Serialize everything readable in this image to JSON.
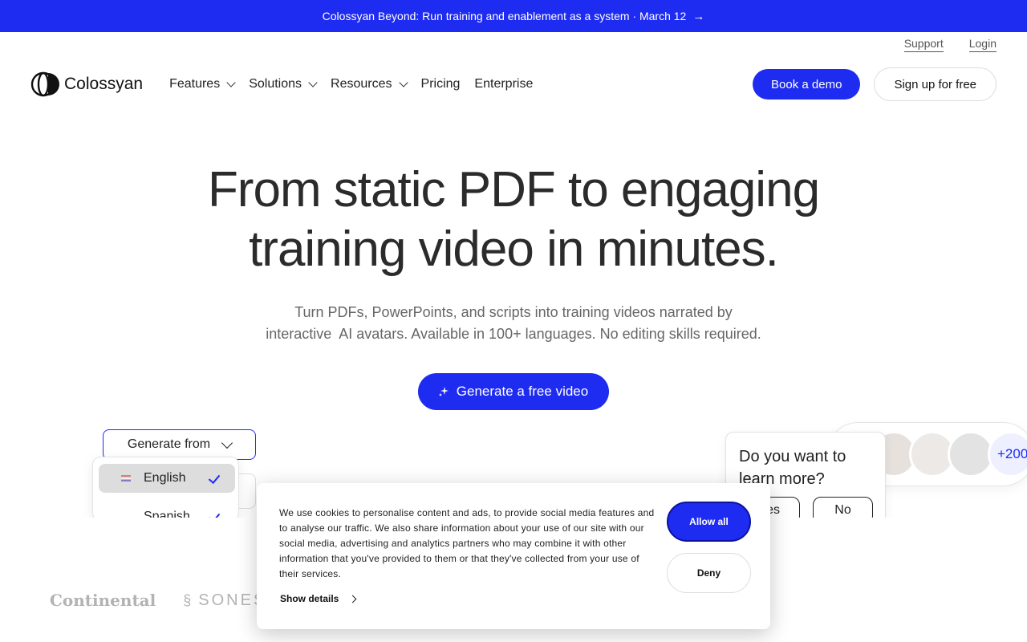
{
  "announcement": {
    "text": "Colossyan Beyond: Run training and enablement as a system · March 12",
    "arrow_icon": "arrow-right-icon"
  },
  "top_links": {
    "support": "Support",
    "login": "Login"
  },
  "nav": {
    "brand": "Colossyan",
    "menu": [
      {
        "label": "Features",
        "has_dropdown": true
      },
      {
        "label": "Solutions",
        "has_dropdown": true
      },
      {
        "label": "Resources",
        "has_dropdown": true
      },
      {
        "label": "Pricing",
        "has_dropdown": false
      },
      {
        "label": "Enterprise",
        "has_dropdown": false
      }
    ],
    "book_demo": "Book a demo",
    "sign_up": "Sign up for free"
  },
  "hero": {
    "title_line1": "From static PDF to engaging",
    "title_line2": "training video in minutes.",
    "subtitle_line1": "Turn PDFs, PowerPoints, and scripts into training videos narrated by",
    "subtitle_line2": "interactive  AI avatars. Available in 100+ languages. No editing skills required.",
    "cta": "Generate a free video"
  },
  "demo": {
    "generate_from": "Generate from",
    "languages": [
      {
        "label": "English",
        "selected": true
      },
      {
        "label": "Spanish",
        "selected": true
      }
    ],
    "learn_more": {
      "question_line1": "Do you want to",
      "question_line2": "learn more?",
      "yes": "es",
      "no": "No"
    },
    "avatars_more": "+200"
  },
  "client_logos": [
    "Continental",
    "SONEST"
  ],
  "cookie_banner": {
    "text": "We use cookies to personalise content and ads, to provide social media features and to analyse our traffic. We also share information about your use of our site with our social media, advertising and analytics partners who may combine it with other information that you've provided to them or that they've collected from your use of their services.",
    "show_details": "Show details",
    "allow_all": "Allow all",
    "deny": "Deny"
  },
  "colors": {
    "brand_blue": "#1e2bf0"
  }
}
